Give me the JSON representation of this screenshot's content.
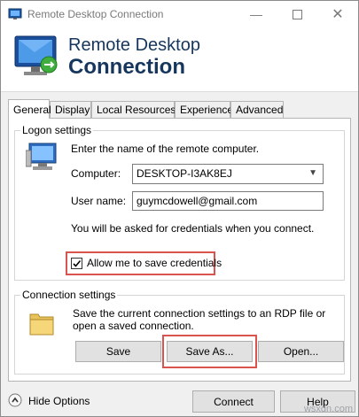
{
  "window": {
    "title": "Remote Desktop Connection"
  },
  "banner": {
    "line1": "Remote Desktop",
    "line2": "Connection"
  },
  "tabs": [
    {
      "label": "General"
    },
    {
      "label": "Display"
    },
    {
      "label": "Local Resources"
    },
    {
      "label": "Experience"
    },
    {
      "label": "Advanced"
    }
  ],
  "logon": {
    "title": "Logon settings",
    "prompt": "Enter the name of the remote computer.",
    "computer_label": "Computer:",
    "computer_value": "DESKTOP-I3AK8EJ",
    "username_label": "User name:",
    "username_value": "guymcdowell@gmail.com",
    "credentials_note": "You will be asked for credentials when you connect.",
    "save_credentials_label": "Allow me to save credentials",
    "save_credentials_checked": true
  },
  "connection": {
    "title": "Connection settings",
    "description": "Save the current connection settings to an RDP file or open a saved connection.",
    "save_label": "Save",
    "save_as_label": "Save As...",
    "open_label": "Open..."
  },
  "footer": {
    "hide_options_label": "Hide Options",
    "connect_label": "Connect",
    "help_label": "Help"
  },
  "watermark": "wsxdn.com"
}
